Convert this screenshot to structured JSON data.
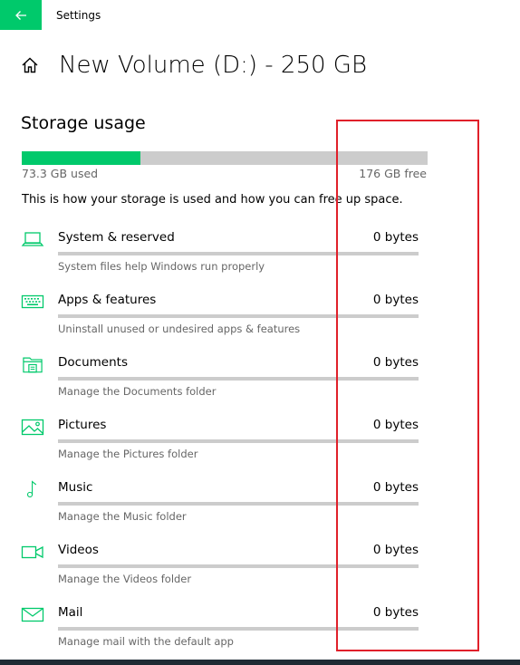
{
  "window": {
    "app_title": "Settings"
  },
  "header": {
    "title": "New Volume (D:) - 250 GB"
  },
  "storage": {
    "heading": "Storage usage",
    "used_label": "73.3 GB used",
    "free_label": "176 GB free",
    "used_fraction": 0.293,
    "description": "This is how your storage is used and how you can free up space."
  },
  "categories": [
    {
      "name": "System & reserved",
      "size": "0 bytes",
      "description": "System files help Windows run properly",
      "icon": "laptop-icon",
      "fill_fraction": 0
    },
    {
      "name": "Apps & features",
      "size": "0 bytes",
      "description": "Uninstall unused or undesired apps & features",
      "icon": "keyboard-icon",
      "fill_fraction": 0
    },
    {
      "name": "Documents",
      "size": "0 bytes",
      "description": "Manage the Documents folder",
      "icon": "documents-folder-icon",
      "fill_fraction": 0
    },
    {
      "name": "Pictures",
      "size": "0 bytes",
      "description": "Manage the Pictures folder",
      "icon": "picture-icon",
      "fill_fraction": 0
    },
    {
      "name": "Music",
      "size": "0 bytes",
      "description": "Manage the Music folder",
      "icon": "music-note-icon",
      "fill_fraction": 0
    },
    {
      "name": "Videos",
      "size": "0 bytes",
      "description": "Manage the Videos folder",
      "icon": "video-camera-icon",
      "fill_fraction": 0
    },
    {
      "name": "Mail",
      "size": "0 bytes",
      "description": "Manage mail with the default app",
      "icon": "mail-icon",
      "fill_fraction": 0
    }
  ],
  "colors": {
    "accent": "#00c96b",
    "bar_background": "#cccccc",
    "secondary_text": "#666666",
    "highlight_border": "#e0202a"
  }
}
